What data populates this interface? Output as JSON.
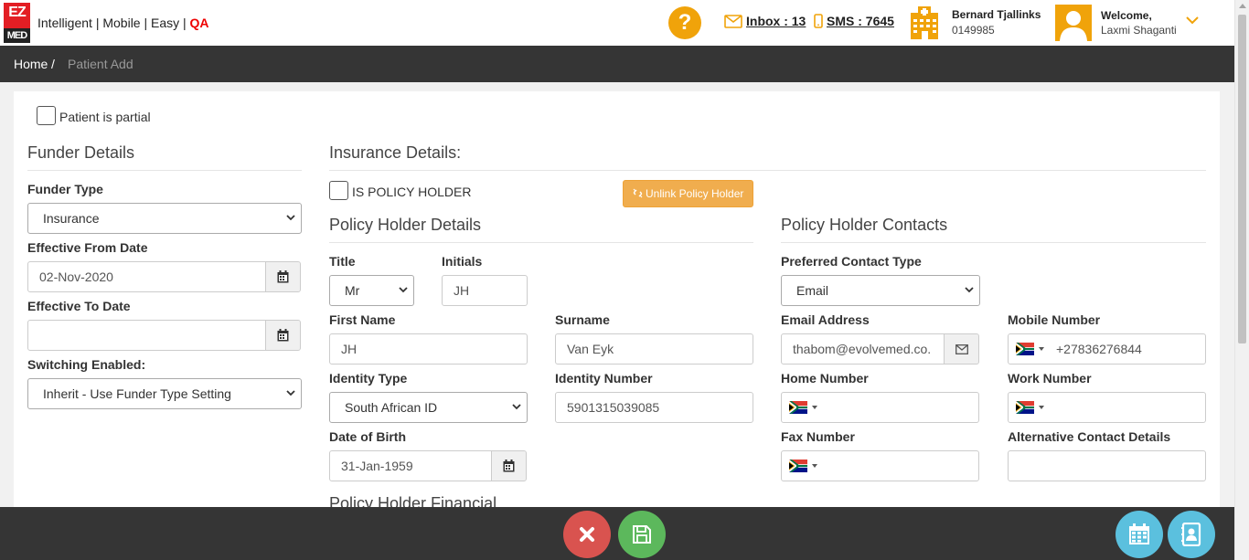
{
  "header": {
    "logo_top": "EZ",
    "logo_bottom": "MED",
    "tagline": "Intelligent | Mobile | Easy | ",
    "environment": "QA",
    "help_symbol": "?",
    "inbox_label": "Inbox : 13",
    "sms_label": "SMS : 7645",
    "doctor_name": "Bernard Tjallinks",
    "doctor_id": "0149985",
    "welcome": "Welcome,",
    "user_name": "Laxmi Shaganti"
  },
  "breadcrumb": {
    "home": "Home",
    "separator": "/",
    "current": "Patient Add"
  },
  "form": {
    "patient_partial_label": "Patient is partial",
    "funder": {
      "title": "Funder Details",
      "funder_type_label": "Funder Type",
      "funder_type_value": "Insurance",
      "effective_from_label": "Effective From Date",
      "effective_from_value": "02-Nov-2020",
      "effective_to_label": "Effective To Date",
      "effective_to_value": "",
      "switching_label": "Switching Enabled:",
      "switching_value": "Inherit - Use Funder Type Setting"
    },
    "insurance": {
      "title": "Insurance Details:",
      "policy_holder_checkbox": "IS POLICY HOLDER",
      "unlink_button": "Unlink Policy Holder"
    },
    "policy_holder": {
      "title": "Policy Holder Details",
      "title_label": "Title",
      "title_value": "Mr",
      "initials_label": "Initials",
      "initials_value": "JH",
      "first_name_label": "First Name",
      "first_name_value": "JH",
      "surname_label": "Surname",
      "surname_value": "Van Eyk",
      "identity_type_label": "Identity Type",
      "identity_type_value": "South African ID",
      "identity_number_label": "Identity Number",
      "identity_number_value": "5901315039085",
      "dob_label": "Date of Birth",
      "dob_value": "31-Jan-1959",
      "financial_title": "Policy Holder Financial"
    },
    "contacts": {
      "title": "Policy Holder Contacts",
      "preferred_label": "Preferred Contact Type",
      "preferred_value": "Email",
      "email_label": "Email Address",
      "email_value": "thabom@evolvemed.co.",
      "mobile_label": "Mobile Number",
      "mobile_value": "+27836276844",
      "home_label": "Home Number",
      "home_value": "",
      "work_label": "Work Number",
      "work_value": "",
      "fax_label": "Fax Number",
      "fax_value": "",
      "alt_label": "Alternative Contact Details",
      "alt_value": ""
    }
  },
  "colors": {
    "accent_orange": "#f0a30a",
    "qa_red": "#e00000",
    "cancel_red": "#d9534f",
    "save_green": "#5cb85c",
    "action_blue": "#5bc0de",
    "dark_bar": "#353535"
  },
  "icons": {
    "help": "question-icon",
    "inbox": "envelope-icon",
    "sms": "mobile-phone-icon",
    "practice": "hospital-icon",
    "calendar": "calendar-icon",
    "email_addon": "envelope-icon",
    "cancel": "close-icon",
    "save": "floppy-disk-icon",
    "bottom_calendar": "calendar-icon",
    "contacts": "address-book-icon"
  }
}
